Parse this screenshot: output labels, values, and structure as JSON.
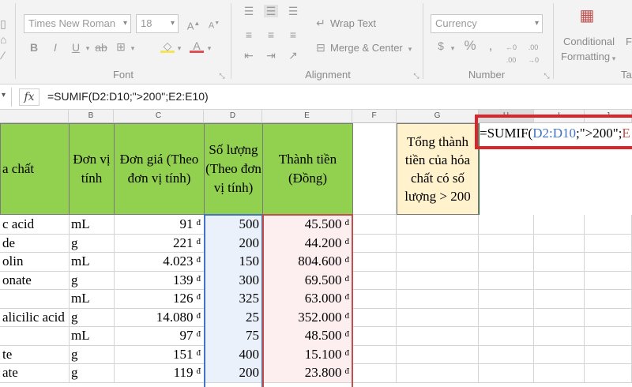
{
  "ribbon": {
    "font": {
      "font_name": "Times New Roman",
      "font_size": "18",
      "bold": "B",
      "italic": "I",
      "underline": "U",
      "group_label": "Font"
    },
    "alignment": {
      "wrap_text": "Wrap Text",
      "merge_center": "Merge & Center",
      "group_label": "Alignment"
    },
    "number": {
      "format": "Currency",
      "percent": "%",
      "group_label": "Number"
    },
    "styles": {
      "conditional": "Conditional",
      "formatting": "Formatting",
      "cut_label_1": "Fo",
      "cut_label_2": "Tab"
    }
  },
  "formula_bar": {
    "fx": "fx",
    "formula": "=SUMIF(D2:D10;\">200\";E2:E10)"
  },
  "columns": [
    "B",
    "C",
    "D",
    "E",
    "F",
    "G",
    "H",
    "I",
    "J"
  ],
  "headers": {
    "a": "a chất",
    "b": "Đơn vị tính",
    "c": "Đơn giá (Theo đơn vị tính)",
    "d": "Số lượng (Theo đơn vị tính)",
    "e": "Thành tiền (Đồng)",
    "g": "Tổng thành tiền của hóa chất có số lượng > 200"
  },
  "editing_cell": {
    "prefix": "=SUMIF(",
    "range1": "D2:D10",
    "middle": ";\">200\";",
    "rest": "E"
  },
  "currency_symbol": "đ",
  "rows": [
    {
      "a": "c acid",
      "b": "mL",
      "c": "91",
      "d": "500",
      "e": "45.500"
    },
    {
      "a": "de",
      "b": "g",
      "c": "221",
      "d": "200",
      "e": "44.200"
    },
    {
      "a": "olin",
      "b": "mL",
      "c": "4.023",
      "d": "150",
      "e": "804.600"
    },
    {
      "a": "onate",
      "b": "g",
      "c": "139",
      "d": "300",
      "e": "69.500"
    },
    {
      "a": "",
      "b": "mL",
      "c": "126",
      "d": "325",
      "e": "63.000"
    },
    {
      "a": "alicilic acid",
      "b": "g",
      "c": "14.080",
      "d": "25",
      "e": "352.000"
    },
    {
      "a": "",
      "b": "mL",
      "c": "97",
      "d": "75",
      "e": "48.500"
    },
    {
      "a": "te",
      "b": "g",
      "c": "151",
      "d": "400",
      "e": "15.100"
    },
    {
      "a": "ate",
      "b": "g",
      "c": "119",
      "d": "200",
      "e": "23.800"
    }
  ],
  "colors": {
    "header_fill": "#92d050",
    "result_fill": "#fff2cc",
    "highlight_border": "#d9262c",
    "range_blue": "#4472c4",
    "range_red": "#c0504d"
  }
}
